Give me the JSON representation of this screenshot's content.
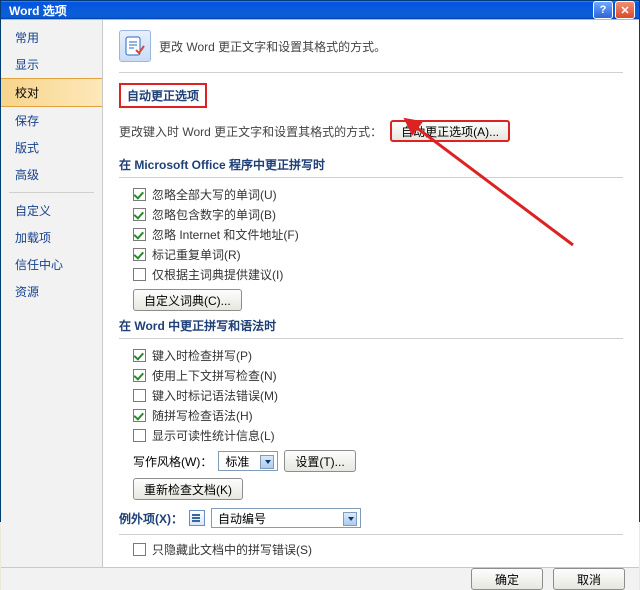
{
  "window": {
    "title": "Word 选项"
  },
  "sidebar": {
    "items": [
      {
        "label": "常用"
      },
      {
        "label": "显示"
      },
      {
        "label": "校对"
      },
      {
        "label": "保存"
      },
      {
        "label": "版式"
      },
      {
        "label": "高级"
      },
      {
        "label": "自定义"
      },
      {
        "label": "加载项"
      },
      {
        "label": "信任中心"
      },
      {
        "label": "资源"
      }
    ],
    "selected_index": 2
  },
  "header": {
    "text": "更改 Word 更正文字和设置其格式的方式。"
  },
  "autocorrect": {
    "section_title": "自动更正选项",
    "desc": "更改键入时 Word 更正文字和设置其格式的方式：",
    "button": "自动更正选项(A)..."
  },
  "office_spelling": {
    "title": "在 Microsoft Office 程序中更正拼写时",
    "checks": [
      {
        "label": "忽略全部大写的单词(U)",
        "checked": true
      },
      {
        "label": "忽略包含数字的单词(B)",
        "checked": true
      },
      {
        "label": "忽略 Internet 和文件地址(F)",
        "checked": true
      },
      {
        "label": "标记重复单词(R)",
        "checked": true
      },
      {
        "label": "仅根据主词典提供建议(I)",
        "checked": false
      }
    ],
    "custom_dict_btn": "自定义词典(C)..."
  },
  "word_spelling": {
    "title": "在 Word 中更正拼写和语法时",
    "checks": [
      {
        "label": "键入时检查拼写(P)",
        "checked": true
      },
      {
        "label": "使用上下文拼写检查(N)",
        "checked": true
      },
      {
        "label": "键入时标记语法错误(M)",
        "checked": false
      },
      {
        "label": "随拼写检查语法(H)",
        "checked": true
      },
      {
        "label": "显示可读性统计信息(L)",
        "checked": false
      }
    ],
    "style_label": "写作风格(W)：",
    "style_value": "标准",
    "settings_btn": "设置(T)...",
    "recheck_btn": "重新检查文档(K)"
  },
  "exceptions": {
    "title": "例外项(X)：",
    "doc_value": "自动编号",
    "hidden_check": {
      "label": "只隐藏此文档中的拼写错误(S)",
      "checked": false
    }
  },
  "footer": {
    "ok": "确定",
    "cancel": "取消"
  }
}
